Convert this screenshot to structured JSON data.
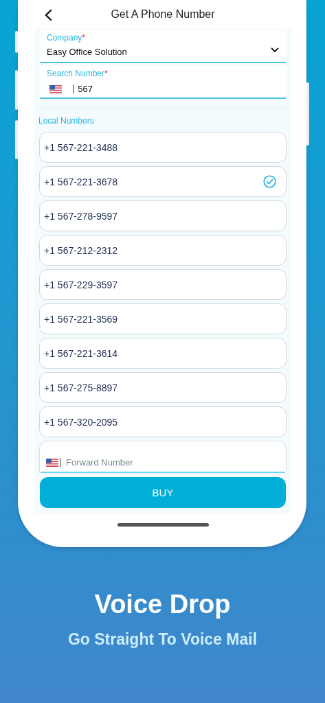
{
  "header": {
    "title": "Get A Phone Number"
  },
  "company": {
    "label": "Company",
    "required_mark": "*",
    "value": "Easy Office Solution"
  },
  "search": {
    "label": "Search Number",
    "required_mark": "*",
    "value": "567"
  },
  "section_title": "Local Numbers",
  "numbers": [
    {
      "number": "+1 567-221-3488",
      "selected": false
    },
    {
      "number": "+1 567-221-3678",
      "selected": true
    },
    {
      "number": "+1 567-278-9597",
      "selected": false
    },
    {
      "number": "+1 567-212-2312",
      "selected": false
    },
    {
      "number": "+1 567-229-3597",
      "selected": false
    },
    {
      "number": "+1 567-221-3569",
      "selected": false
    },
    {
      "number": "+1 567-221-3614",
      "selected": false
    },
    {
      "number": "+1 567-275-8897",
      "selected": false
    },
    {
      "number": "+1 567-320-2095",
      "selected": false
    }
  ],
  "forward": {
    "placeholder": "Forward Number"
  },
  "buy_button": "BUY",
  "promo": {
    "title": "Voice Drop",
    "subtitle": "Go Straight To Voice Mail"
  }
}
